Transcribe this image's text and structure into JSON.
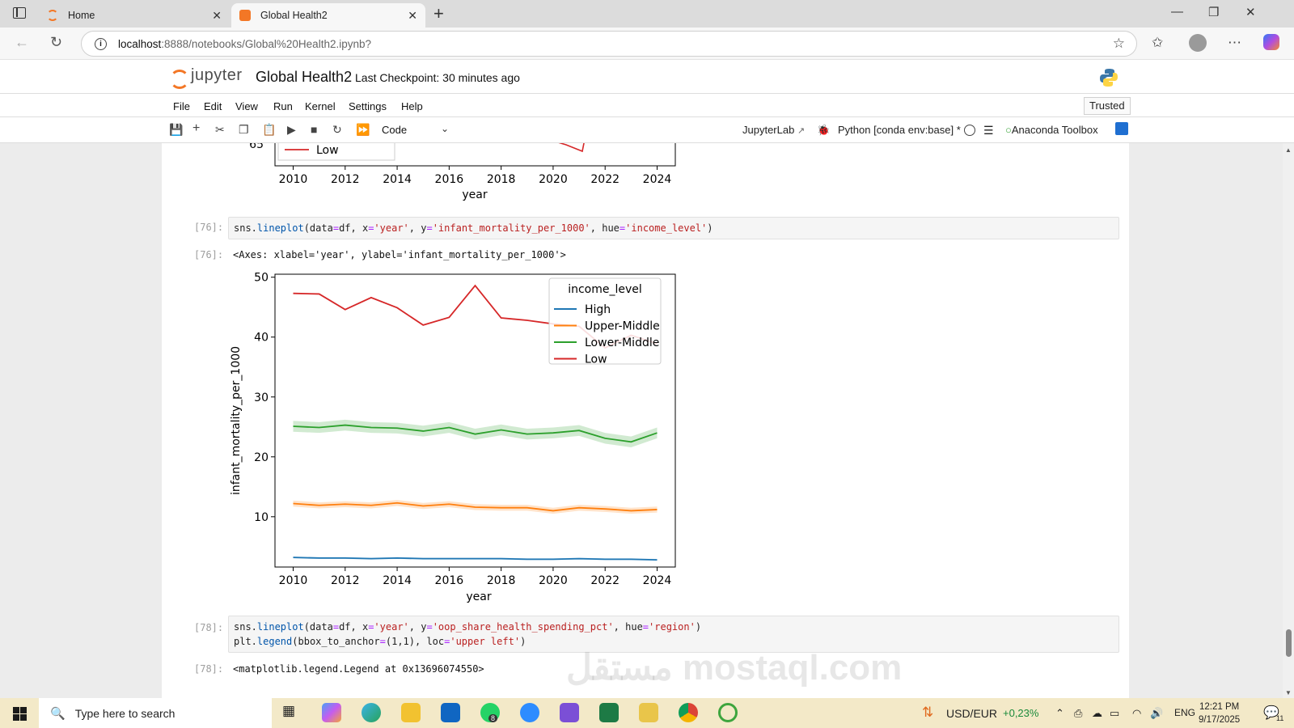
{
  "browser": {
    "tabs": [
      {
        "title": "Home"
      },
      {
        "title": "Global Health2"
      }
    ],
    "url_host": "localhost",
    "url_path": ":8888/notebooks/Global%20Health2.ipynb?"
  },
  "jupyter": {
    "logo_text": "jupyter",
    "notebook_title": "Global Health2",
    "checkpoint": "Last Checkpoint: 30 minutes ago",
    "menu": [
      "File",
      "Edit",
      "View",
      "Run",
      "Kernel",
      "Settings",
      "Help"
    ],
    "trusted": "Trusted",
    "cell_type": "Code",
    "jupyterlab_link": "JupyterLab",
    "kernel": "Python [conda env:base] *",
    "anaconda": "Anaconda Toolbox"
  },
  "cells": {
    "c76_prompt": "[76]:",
    "c76_out_prompt": "[76]:",
    "c76_out": "<Axes: xlabel='year', ylabel='infant_mortality_per_1000'>",
    "c78_prompt": "[78]:",
    "c78_out_prompt": "[78]:",
    "c78_out": "<matplotlib.legend.Legend at 0x13696074550>"
  },
  "prev_chart": {
    "ytick": "65",
    "legend": "Low",
    "xticks": [
      "2010",
      "2012",
      "2014",
      "2016",
      "2018",
      "2020",
      "2022",
      "2024"
    ],
    "xlabel": "year"
  },
  "chart_data": {
    "type": "line",
    "xlabel": "year",
    "ylabel": "infant_mortality_per_1000",
    "x": [
      2010,
      2011,
      2012,
      2013,
      2014,
      2015,
      2016,
      2017,
      2018,
      2019,
      2020,
      2021,
      2022,
      2023,
      2024
    ],
    "xlim": [
      2009.3,
      2024.7
    ],
    "ylim": [
      1.6,
      50.5
    ],
    "xticks": [
      2010,
      2012,
      2014,
      2016,
      2018,
      2020,
      2022,
      2024
    ],
    "yticks": [
      10,
      20,
      30,
      40,
      50
    ],
    "legend_title": "income_level",
    "legend_loc": "upper right",
    "series": [
      {
        "name": "High",
        "color": "#1f77b4",
        "values": [
          3.2,
          3.1,
          3.1,
          3.0,
          3.1,
          3.0,
          3.0,
          3.0,
          3.0,
          2.9,
          2.9,
          3.0,
          2.9,
          2.9,
          2.8
        ],
        "band": 0.15
      },
      {
        "name": "Upper-Middle",
        "color": "#ff7f0e",
        "values": [
          12.2,
          11.9,
          12.1,
          11.9,
          12.3,
          11.8,
          12.1,
          11.6,
          11.5,
          11.5,
          11.0,
          11.5,
          11.3,
          11.0,
          11.2
        ],
        "band": 0.5
      },
      {
        "name": "Lower-Middle",
        "color": "#2ca02c",
        "values": [
          25.1,
          24.9,
          25.3,
          24.9,
          24.8,
          24.3,
          24.9,
          23.8,
          24.5,
          23.8,
          24.0,
          24.4,
          23.1,
          22.5,
          24.0
        ],
        "band": 0.9
      },
      {
        "name": "Low",
        "color": "#d62728",
        "values": [
          47.3,
          47.2,
          44.6,
          46.6,
          44.9,
          42.0,
          43.3,
          48.6,
          43.2,
          42.8,
          42.2,
          41.8,
          38.2,
          40.3,
          38.9
        ],
        "band": 0
      }
    ]
  },
  "taskbar": {
    "search_placeholder": "Type here to search",
    "currency": "USD/EUR",
    "currency_change": "+0,23%",
    "lang": "ENG",
    "time": "12:21 PM",
    "date": "9/17/2025",
    "notifications": "11",
    "whatsapp_badge": "8"
  },
  "watermark": "مستقل mostaql.com"
}
